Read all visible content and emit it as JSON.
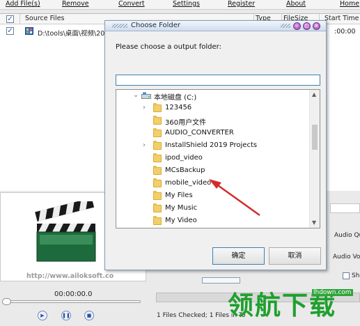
{
  "menu": [
    "Add File(s)",
    "Remove",
    "Convert",
    "Settings",
    "Register",
    "About",
    "Home"
  ],
  "grid": {
    "columns": [
      "Source Files",
      "Type",
      "FileSize",
      "Start Time"
    ],
    "row": {
      "path": "D:\\tools\\桌面\\视频\\20",
      "start": ":00:00"
    }
  },
  "preview": {
    "url": "http://www.ailoksoft.co"
  },
  "player": {
    "time": "00:00:00.0"
  },
  "status": "1 Files Checked; 1 Files in To",
  "side_labels": [
    "Audio Qu",
    "Audio Vol",
    "Sh"
  ],
  "dialog": {
    "title": "Choose Folder",
    "prompt": "Please choose a output folder:",
    "path_value": "",
    "root": "本地磁盘 (C:)",
    "folders": [
      "123456",
      "360用户文件",
      "AUDIO_CONVERTER",
      "InstallShield 2019 Projects",
      "ipod_video",
      "MCsBackup",
      "mobile_video",
      "My Files",
      "My Music",
      "My Video"
    ],
    "ok": "确定",
    "cancel": "取消"
  },
  "watermark": {
    "text": "领航下载",
    "url": "lhdown.com"
  },
  "colors": {
    "folder": "#f3cf6b",
    "accent": "#3c7fb1",
    "arrow": "#d22b2b",
    "watermark": "#1fa02e"
  }
}
